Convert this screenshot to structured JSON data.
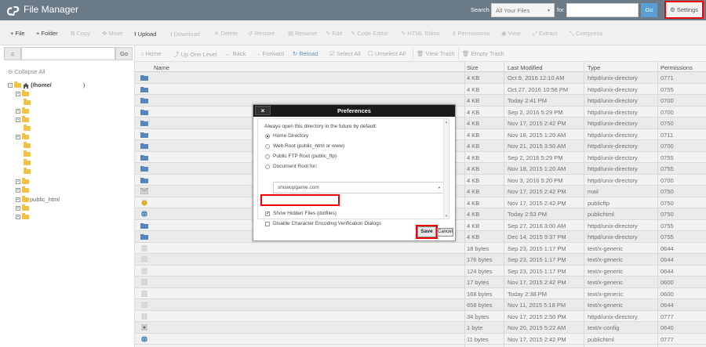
{
  "header": {
    "app_title": "File Manager",
    "search_label": "Search",
    "search_scope": "All Your Files",
    "for_label": "for",
    "search_value": "",
    "go_label": "Go",
    "settings_label": "Settings"
  },
  "toolbar": {
    "file": "File",
    "folder": "Folder",
    "copy": "Copy",
    "move": "Move",
    "upload": "Upload",
    "download": "Download",
    "delete": "Delete",
    "restore": "Restore",
    "rename": "Rename",
    "edit": "Edit",
    "code_editor": "Code Editor",
    "html_editor": "HTML Editor",
    "permissions": "Permissions",
    "view": "View",
    "extract": "Extract",
    "compress": "Compress"
  },
  "left_panel": {
    "path_value": "",
    "go_label": "Go",
    "collapse_all": "Collapse All",
    "root_label": "(/home/",
    "root_suffix": ")",
    "public_html": "public_html"
  },
  "right_toolbar": {
    "home": "Home",
    "up_one_level": "Up One Level",
    "back": "Back",
    "forward": "Forward",
    "reload": "Reload",
    "select_all": "Select All",
    "unselect_all": "Unselect All",
    "view_trash": "View Trash",
    "empty_trash": "Empty Trash"
  },
  "table": {
    "headers": {
      "name": "Name",
      "size": "Size",
      "modified": "Last Modified",
      "type": "Type",
      "perms": "Permissions"
    },
    "rows": [
      {
        "size": "4 KB",
        "modified": "Oct 9, 2016 12:10 AM",
        "type": "httpd/unix-directory",
        "perms": "0771",
        "icon": "folder"
      },
      {
        "size": "4 KB",
        "modified": "Oct 27, 2016 10:56 PM",
        "type": "httpd/unix-directory",
        "perms": "0755",
        "icon": "folder"
      },
      {
        "size": "4 KB",
        "modified": "Today 2:41 PM",
        "type": "httpd/unix-directory",
        "perms": "0700",
        "icon": "folder"
      },
      {
        "size": "4 KB",
        "modified": "Sep 2, 2016 5:29 PM",
        "type": "httpd/unix-directory",
        "perms": "0700",
        "icon": "folder"
      },
      {
        "size": "4 KB",
        "modified": "Nov 17, 2015 2:42 PM",
        "type": "httpd/unix-directory",
        "perms": "0750",
        "icon": "folder"
      },
      {
        "size": "4 KB",
        "modified": "Nov 18, 2015 1:20 AM",
        "type": "httpd/unix-directory",
        "perms": "0711",
        "icon": "folder"
      },
      {
        "size": "4 KB",
        "modified": "Nov 21, 2015 3:50 AM",
        "type": "httpd/unix-directory",
        "perms": "0700",
        "icon": "folder"
      },
      {
        "size": "4 KB",
        "modified": "Sep 2, 2016 5:29 PM",
        "type": "httpd/unix-directory",
        "perms": "0755",
        "icon": "folder"
      },
      {
        "size": "4 KB",
        "modified": "Nov 18, 2015 1:20 AM",
        "type": "httpd/unix-directory",
        "perms": "0755",
        "icon": "folder"
      },
      {
        "size": "4 KB",
        "modified": "Nov 3, 2016 5:20 PM",
        "type": "httpd/unix-directory",
        "perms": "0700",
        "icon": "folder"
      },
      {
        "size": "4 KB",
        "modified": "Nov 17, 2015 2:42 PM",
        "type": "mail",
        "perms": "0750",
        "icon": "mail"
      },
      {
        "size": "4 KB",
        "modified": "Nov 17, 2015 2:42 PM",
        "type": "publicftp",
        "perms": "0750",
        "icon": "ftp"
      },
      {
        "size": "4 KB",
        "modified": "Today 2:53 PM",
        "type": "publichtml",
        "perms": "0750",
        "icon": "globe"
      },
      {
        "size": "4 KB",
        "modified": "Sep 27, 2016 3:00 AM",
        "type": "httpd/unix-directory",
        "perms": "0755",
        "icon": "folder"
      },
      {
        "size": "4 KB",
        "modified": "Dec 14, 2015 9:37 PM",
        "type": "httpd/unix-directory",
        "perms": "0755",
        "icon": "folder"
      },
      {
        "size": "18 bytes",
        "modified": "Sep 23, 2015 1:17 PM",
        "type": "text/x-generic",
        "perms": "0644",
        "icon": "doc"
      },
      {
        "size": "176 bytes",
        "modified": "Sep 23, 2015 1:17 PM",
        "type": "text/x-generic",
        "perms": "0644",
        "icon": "doc"
      },
      {
        "size": "124 bytes",
        "modified": "Sep 23, 2015 1:17 PM",
        "type": "text/x-generic",
        "perms": "0644",
        "icon": "doc"
      },
      {
        "size": "17 bytes",
        "modified": "Nov 17, 2015 2:42 PM",
        "type": "text/x-generic",
        "perms": "0600",
        "icon": "doc"
      },
      {
        "size": "168 bytes",
        "modified": "Today 2:38 PM",
        "type": "text/x-generic",
        "perms": "0600",
        "icon": "doc"
      },
      {
        "size": "658 bytes",
        "modified": "Nov 11, 2015 5:18 PM",
        "type": "text/x-generic",
        "perms": "0644",
        "icon": "doc"
      },
      {
        "size": "34 bytes",
        "modified": "Nov 17, 2015 2:50 PM",
        "type": "httpd/unix-directory",
        "perms": "0777",
        "icon": "doc"
      },
      {
        "size": "1 byte",
        "modified": "Nov 20, 2015 5:22 AM",
        "type": "text/x-config",
        "perms": "0640",
        "icon": "config"
      },
      {
        "size": "11 bytes",
        "modified": "Nov 17, 2015 2:42 PM",
        "type": "publichtml",
        "perms": "0777",
        "icon": "globe"
      }
    ]
  },
  "dialog": {
    "title": "Preferences",
    "intro": "Always open this directory in the future by default:",
    "opt_home": "Home Directory",
    "opt_webroot": "Web Root (public_html or www)",
    "opt_ftproot": "Public FTP Root (public_ftp)",
    "opt_docroot": "Document Root for:",
    "docroot_value": "showupgame.com",
    "show_hidden": "Show Hidden Files (dotfiles)",
    "disable_encoding": "Disable Character Encoding Verification Dialogs",
    "save": "Save",
    "cancel": "Cancel"
  },
  "colors": {
    "header": "#6b7a87",
    "accent": "#5a9fd4",
    "highlight": "#e00000",
    "folder": "#5b8ec9"
  }
}
